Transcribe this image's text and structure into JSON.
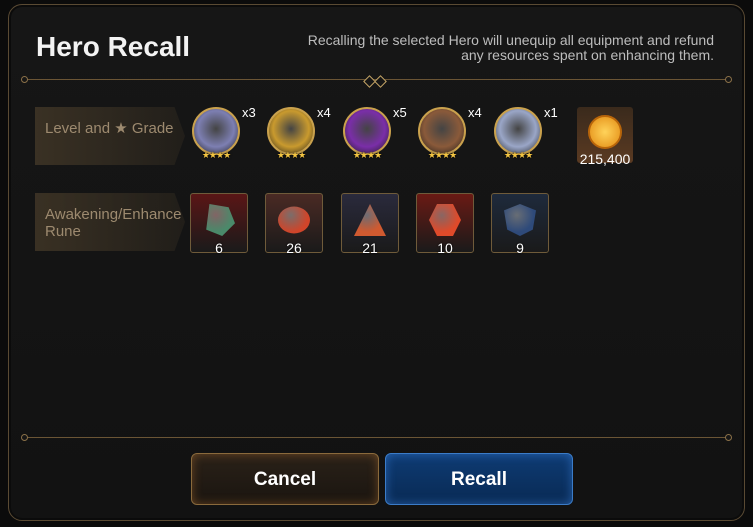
{
  "dialog": {
    "title": "Hero Recall",
    "description": "Recalling the selected Hero will unequip all equipment and refund any resources spent on enhancing them.",
    "rows": [
      {
        "label": "Level and ★ Grade"
      },
      {
        "label": "Awakening/Enhance Rune"
      }
    ],
    "heroes": [
      {
        "icon": "white-hair-hero-portrait",
        "count": "x3",
        "stars": "★★★★",
        "color": "#7d7fb2"
      },
      {
        "icon": "golden-hair-hero-portrait",
        "count": "x4",
        "stars": "★★★★",
        "color": "#c99a2e"
      },
      {
        "icon": "purple-magic-hero-portrait",
        "count": "x5",
        "stars": "★★★★",
        "color": "#7a2ea8"
      },
      {
        "icon": "brown-hair-hero-portrait",
        "count": "x4",
        "stars": "★★★★",
        "color": "#8a5a3a"
      },
      {
        "icon": "silver-armor-hero-portrait",
        "count": "x1",
        "stars": "★★★★",
        "color": "#9aa6c7"
      }
    ],
    "gold": {
      "icon": "gold-coin-icon",
      "amount": "215,400"
    },
    "runes": [
      {
        "icon": "green-stone-rune-icon",
        "count": "6",
        "bg": "#5a1616",
        "gem": "#4a8a6a"
      },
      {
        "icon": "red-oval-rune-icon",
        "count": "26",
        "bg": "#4a2a24",
        "gem": "#d0452a"
      },
      {
        "icon": "red-triangle-rune-icon",
        "count": "21",
        "bg": "#2a2a3c",
        "gem": "#d05a30"
      },
      {
        "icon": "red-hexagon-rune-icon",
        "count": "10",
        "bg": "#6a1a14",
        "gem": "#e04a2a"
      },
      {
        "icon": "blue-shield-rune-icon",
        "count": "9",
        "bg": "#1e2a3c",
        "gem": "#2e4a7a"
      }
    ],
    "buttons": {
      "cancel": "Cancel",
      "recall": "Recall"
    }
  }
}
